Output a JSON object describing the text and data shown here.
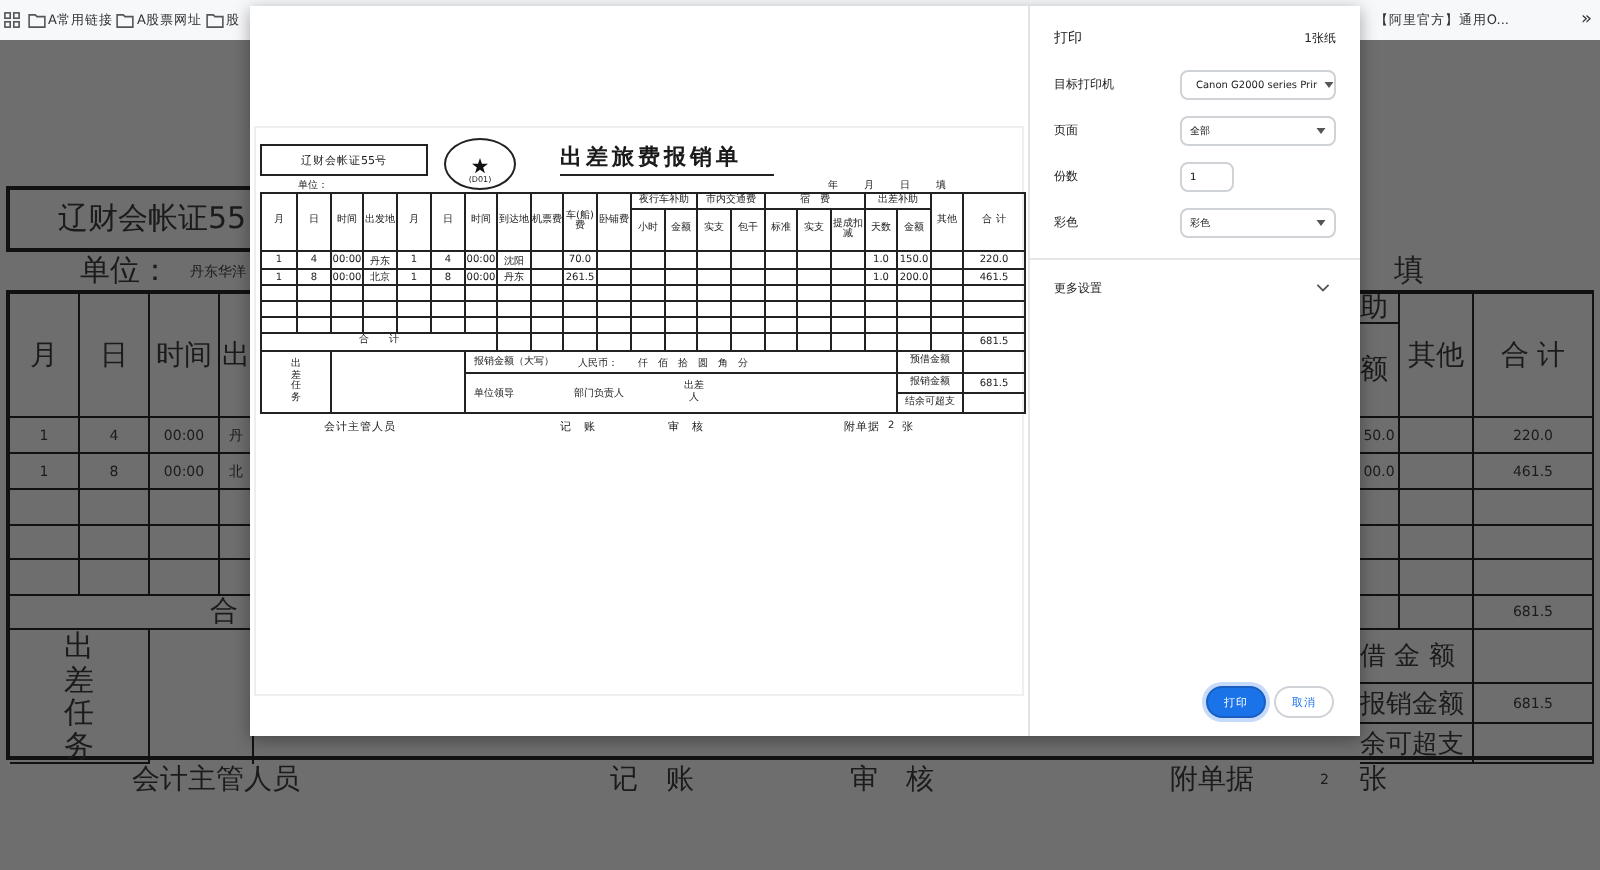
{
  "bookmarks_bar": {
    "items": [
      {
        "label": "A常用链接"
      },
      {
        "label": "A股票网址"
      },
      {
        "label": "股"
      }
    ],
    "right_item": "【阿里官方】通用O...",
    "overflow": "»"
  },
  "background_form": {
    "left": {
      "voucher": "辽财会帐证55",
      "unit_label": "单位：",
      "unit_value": "丹东华洋",
      "columns": [
        "月",
        "日",
        "时间",
        "出"
      ],
      "rows": [
        [
          "1",
          "4",
          "00:00",
          "丹"
        ],
        [
          "1",
          "8",
          "00:00",
          "北"
        ]
      ],
      "total_label": "合",
      "task_label": "出差任务"
    },
    "right": {
      "fill_label": "填",
      "allowance_group": "助",
      "allowance_amount": "额",
      "other": "其他",
      "total": "合 计",
      "rows": [
        [
          "50.0",
          null,
          "220.0"
        ],
        [
          "00.0",
          null,
          "461.5"
        ]
      ],
      "total_value": "681.5",
      "summary": [
        {
          "label": "借 金 额"
        },
        {
          "label": "报销金额",
          "value": "681.5"
        },
        {
          "label": "余可超支"
        }
      ]
    },
    "footer": {
      "accountant": "会计主管人员",
      "bookkeeper": "记　账",
      "auditor": "审　核",
      "attachments_label": "附单据",
      "attachments_count": "2",
      "attachments_unit": "张"
    }
  },
  "print_preview": {
    "voucher": "辽财会帐证55号",
    "stamp_code": "(D01)",
    "title": "出差旅费报销单",
    "unit_label": "单位：",
    "date": {
      "year": "年",
      "month": "月",
      "day": "日",
      "fill": "填"
    },
    "columns": [
      {
        "label": "月"
      },
      {
        "label": "日"
      },
      {
        "label": "时间"
      },
      {
        "label": "出发地"
      },
      {
        "label": "月"
      },
      {
        "label": "日"
      },
      {
        "label": "时间"
      },
      {
        "label": "到达地"
      },
      {
        "label": "机票费"
      },
      {
        "label": "车(船)费"
      },
      {
        "label": "卧铺费"
      },
      {
        "group": "夜行车补助",
        "children": [
          "小时",
          "金额"
        ]
      },
      {
        "group": "市内交通费",
        "children": [
          "实支",
          "包干"
        ]
      },
      {
        "group": "宿　费",
        "children": [
          "标准",
          "实支",
          "提成扣减"
        ]
      },
      {
        "group": "出差补助",
        "children": [
          "天数",
          "金额"
        ]
      },
      {
        "label": "其他"
      },
      {
        "label": "合 计"
      }
    ],
    "rows": [
      [
        "1",
        "4",
        "00:00",
        "丹东",
        "1",
        "4",
        "00:00",
        "沈阳",
        null,
        "70.0",
        null,
        null,
        null,
        null,
        null,
        null,
        null,
        null,
        "1.0",
        "150.0",
        null,
        "220.0"
      ],
      [
        "1",
        "8",
        "00:00",
        "北京",
        "1",
        "8",
        "00:00",
        "丹东",
        null,
        "261.5",
        null,
        null,
        null,
        null,
        null,
        null,
        null,
        null,
        "1.0",
        "200.0",
        null,
        "461.5"
      ]
    ],
    "total_label": "合　　计",
    "total_value": "681.5",
    "task_label": "出差任务",
    "amount_label": "报销金额（大写）",
    "currency_label": "人民币：",
    "amount_units": "仟　佰　拾　圆　角　分",
    "signatures": [
      "单位领导",
      "部门负责人",
      "出差人"
    ],
    "summary": [
      {
        "label": "预借金额"
      },
      {
        "label": "报销金额",
        "value": "681.5"
      },
      {
        "label": "结余可超支"
      }
    ],
    "footer": {
      "accountant": "会计主管人员",
      "bookkeeper": "记　账",
      "auditor": "审　核",
      "attachments_label": "附单据",
      "attachments_count": "2",
      "attachments_unit": "张"
    }
  },
  "print_panel": {
    "title": "打印",
    "sheet_count": "1张纸",
    "settings": [
      {
        "kind": "printer",
        "label": "目标打印机",
        "value": "Canon G2000 series Prir"
      },
      {
        "kind": "select",
        "label": "页面",
        "value": "全部"
      },
      {
        "kind": "number",
        "label": "份数",
        "value": "1"
      },
      {
        "kind": "select",
        "label": "彩色",
        "value": "彩色"
      }
    ],
    "more_settings": {
      "label": "更多设置",
      "expanded": false
    },
    "buttons": [
      {
        "label": "打印",
        "primary": true
      },
      {
        "label": "取消",
        "primary": false
      }
    ]
  }
}
